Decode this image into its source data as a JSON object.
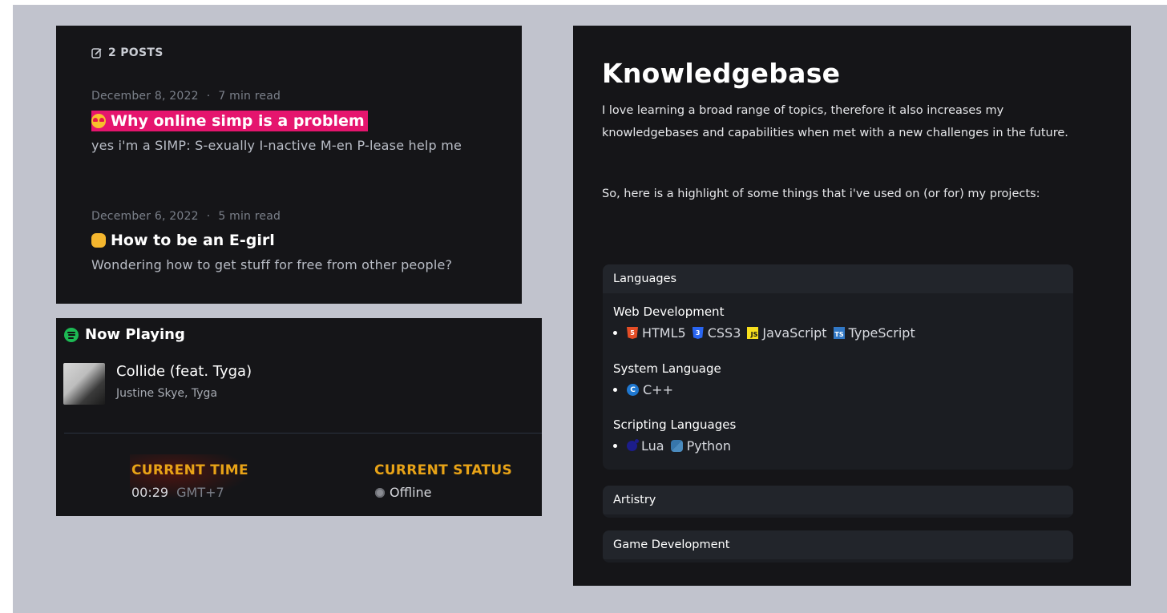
{
  "posts": {
    "count_label": "2 POSTS",
    "items": [
      {
        "date": "December 8, 2022",
        "separator": "·",
        "read_time": "7 min read",
        "title": "Why online simp is a problem",
        "description": "yes i'm a SIMP: S-exually I-nactive M-en P-lease help me",
        "emoji": "heart-eyes-emoji",
        "highlight_color": "#e5156e"
      },
      {
        "date": "December 6, 2022",
        "separator": "·",
        "read_time": "5 min read",
        "title": "How to be an E-girl",
        "description": "Wondering how to get stuff for free from other people?",
        "emoji": "girl-emoji"
      }
    ]
  },
  "now_playing": {
    "title": "Now Playing",
    "track": "Collide (feat. Tyga)",
    "artist": "Justine Skye, Tyga",
    "current_time_label": "CURRENT TIME",
    "current_time": "00:29",
    "timezone": "GMT+7",
    "current_status_label": "CURRENT STATUS",
    "status": "Offline",
    "accent_color": "#e8a317",
    "spotify_color": "#1db954"
  },
  "knowledgebase": {
    "title": "Knowledgebase",
    "paragraph_1": "I love learning a broad range of topics, therefore it also increases my knowledgebases and capabilities when met with a new challenges in the future.",
    "paragraph_2": "So, here is a highlight of some things that i've used on (or for) my projects:",
    "sections": {
      "languages": {
        "label": "Languages",
        "groups": [
          {
            "title": "Web Development",
            "items": [
              "HTML5",
              "CSS3",
              "JavaScript",
              "TypeScript"
            ]
          },
          {
            "title": "System Language",
            "items": [
              "C++"
            ]
          },
          {
            "title": "Scripting Languages",
            "items": [
              "Lua",
              "Python"
            ]
          }
        ]
      },
      "artistry": {
        "label": "Artistry"
      },
      "game_development": {
        "label": "Game Development"
      }
    }
  }
}
